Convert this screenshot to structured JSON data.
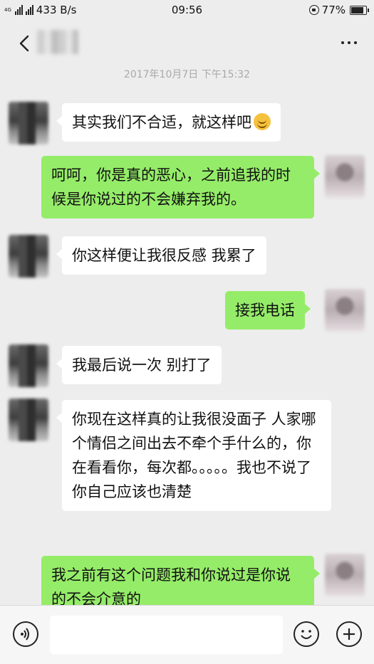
{
  "status_bar": {
    "network_label": "4G",
    "net_speed": "433 B/s",
    "time": "09:56",
    "battery": "77%",
    "battery_level": 0.77
  },
  "nav": {
    "contact_name_blurred": true
  },
  "timestamp": "2017年10月7日 下午15:32",
  "messages": [
    {
      "sender": "other",
      "text": "其实我们不合适，就这样吧",
      "emoji": "smile"
    },
    {
      "sender": "self",
      "text": "呵呵，你是真的恶心，之前追我的时候是你说过的不会嫌弃我的。"
    },
    {
      "sender": "other",
      "text": "你这样便让我很反感 我累了"
    },
    {
      "sender": "self",
      "text": "接我电话"
    },
    {
      "sender": "other",
      "text": "我最后说一次 别打了"
    },
    {
      "sender": "other",
      "text": "你现在这样真的让我很没面子 人家哪个情侣之间出去不牵个手什么的，你在看看你，每次都。。。。。我也不说了你自己应该也清楚"
    },
    {
      "sender": "self",
      "text": "我之前有这个问题我和你说过是你说的不会介意的"
    }
  ],
  "input_bar": {
    "input_value": ""
  },
  "colors": {
    "self_bubble": "#95ec69",
    "other_bubble": "#ffffff",
    "background": "#ededed"
  }
}
